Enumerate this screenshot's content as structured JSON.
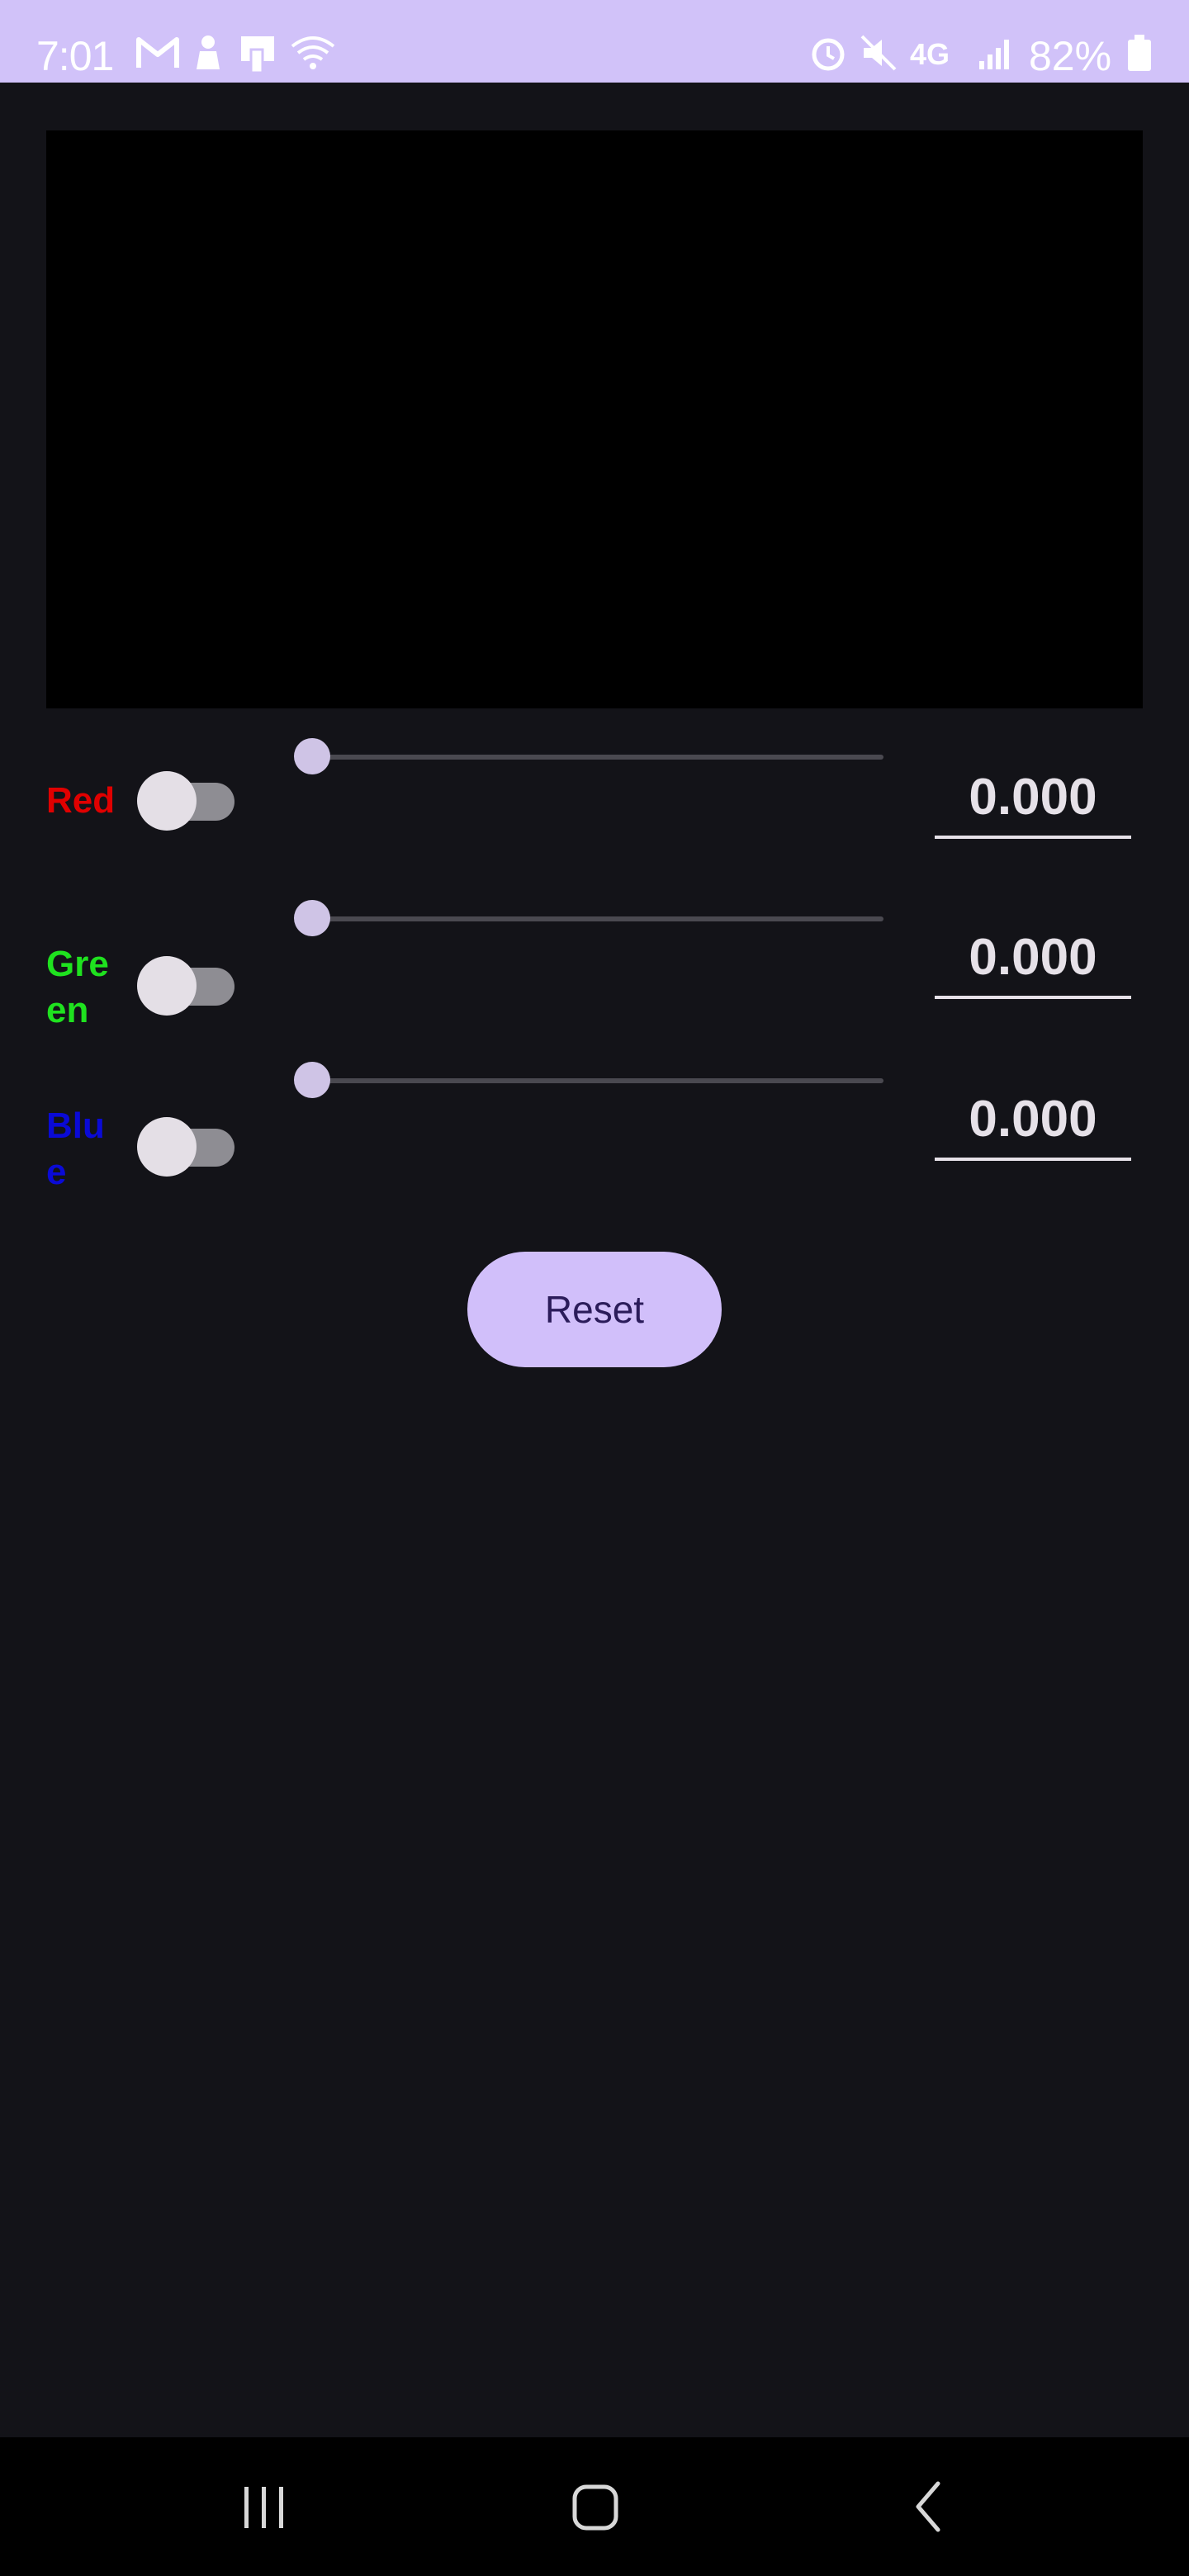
{
  "status_bar": {
    "time": "7:01",
    "battery": "82%",
    "icons": [
      "gmail-icon",
      "person-icon",
      "media-icon",
      "wifi-icon",
      "alarm-icon",
      "mute-icon",
      "4g-lte-icon",
      "signal-icon",
      "battery-icon"
    ]
  },
  "preview": {
    "color": "#000000"
  },
  "channels": [
    {
      "name": "Red",
      "color": "#e00000",
      "enabled": false,
      "slider_value": 0.0,
      "value_text": "0.000"
    },
    {
      "name": "Green",
      "color": "#1fe21f",
      "enabled": false,
      "slider_value": 0.0,
      "value_text": "0.000"
    },
    {
      "name": "Blue",
      "color": "#0a0ad6",
      "enabled": false,
      "slider_value": 0.0,
      "value_text": "0.000"
    }
  ],
  "reset": {
    "label": "Reset"
  },
  "nav_bar": {
    "icons": [
      "recent-apps-icon",
      "home-icon",
      "back-icon"
    ]
  }
}
